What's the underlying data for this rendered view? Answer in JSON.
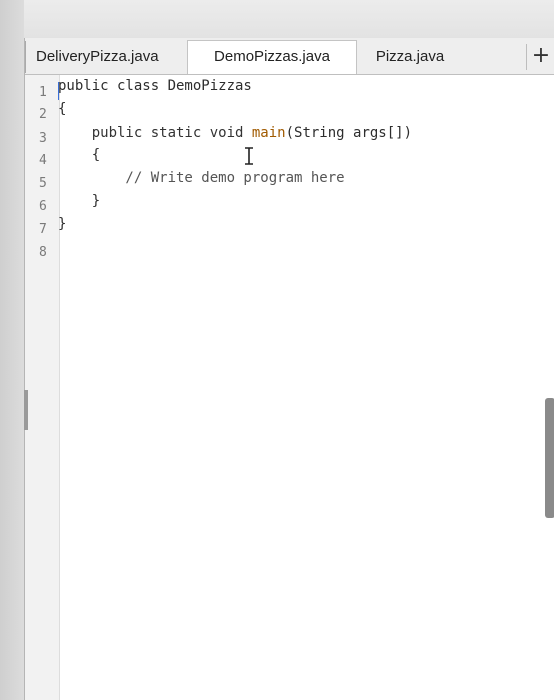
{
  "tabs": [
    {
      "label": "DeliveryPizza.java",
      "active": false
    },
    {
      "label": "DemoPizzas.java",
      "active": true
    },
    {
      "label": "Pizza.java",
      "active": false
    }
  ],
  "add_tab_label": "+",
  "line_numbers": [
    "1",
    "2",
    "3",
    "4",
    "5",
    "6",
    "7",
    "8"
  ],
  "code": {
    "line1": "public class DemoPizzas",
    "line2": "{",
    "line3_pre": "    public static void ",
    "line3_method": "main",
    "line3_post": "(String args[])",
    "line4": "    {",
    "line5": "        // Write demo program here",
    "line6": "    }",
    "line7": "}",
    "line8": ""
  },
  "colors": {
    "method": "#a05a00",
    "cursor": "#3a6fd8"
  }
}
